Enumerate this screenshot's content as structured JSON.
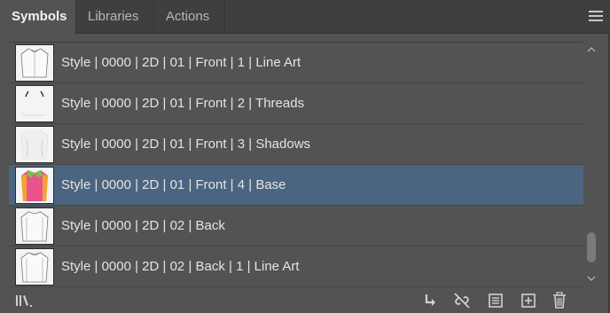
{
  "tabs": [
    {
      "label": "Symbols"
    },
    {
      "label": "Libraries"
    },
    {
      "label": "Actions"
    }
  ],
  "symbols": [
    {
      "label": "Style | 0000 | 2D | 01 | Front | 1 | Line Art",
      "thumb_icon": "shirt-line-art-icon"
    },
    {
      "label": "Style | 0000 | 2D | 01 | Front | 2 | Threads",
      "thumb_icon": "shirt-threads-icon"
    },
    {
      "label": "Style | 0000 | 2D | 01 | Front | 3 | Shadows",
      "thumb_icon": "shirt-shadows-icon"
    },
    {
      "label": "Style | 0000 | 2D | 01 | Front | 4 | Base",
      "thumb_icon": "shirt-base-color-icon",
      "selected": true
    },
    {
      "label": "Style | 0000 | 2D | 02 | Back",
      "thumb_icon": "shirt-back-icon"
    },
    {
      "label": "Style | 0000 | 2D | 02 | Back | 1 | Line Art",
      "thumb_icon": "shirt-back-line-art-icon"
    }
  ],
  "toolbar": {
    "icons": [
      "symbol-libraries-menu-icon",
      "place-symbol-instance-icon",
      "break-link-icon",
      "symbol-options-icon",
      "new-symbol-icon",
      "delete-symbol-icon"
    ]
  },
  "colors": {
    "panel_bg": "#535353",
    "tabbar_bg": "#3f3f3f",
    "selection": "#4b6580",
    "text": "#e4e4e4",
    "base_pink": "#e9548f",
    "base_orange": "#f2a531",
    "base_green": "#7cc04a"
  }
}
